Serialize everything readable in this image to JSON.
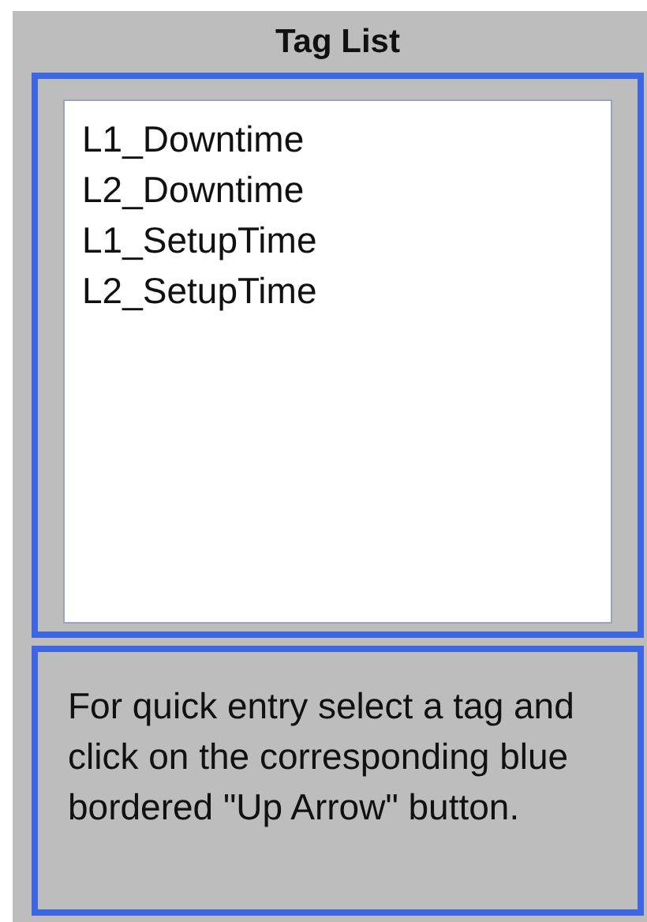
{
  "panel": {
    "title": "Tag List"
  },
  "tag_list": {
    "items": [
      {
        "label": "L1_Downtime",
        "selected": false
      },
      {
        "label": "L2_Downtime",
        "selected": false
      },
      {
        "label": "L1_SetupTime",
        "selected": false
      },
      {
        "label": "L2_SetupTime",
        "selected": false
      }
    ]
  },
  "hint": "For quick entry select a tag and click on the corresponding blue bordered \"Up Arrow\" button."
}
